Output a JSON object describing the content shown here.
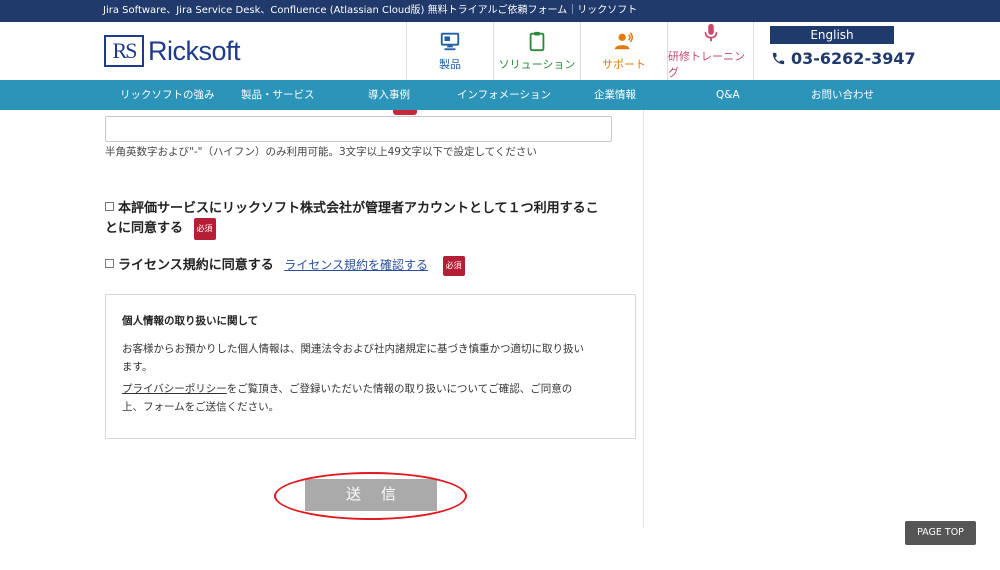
{
  "topbar": {
    "text": "Jira Software、Jira Service Desk、Confluence (Atlassian Cloud版) 無料トライアルご依頼フォーム｜リックソフト"
  },
  "logo": {
    "mark": "RS",
    "name": "Ricksoft"
  },
  "header_nav": [
    {
      "label": "製品",
      "icon": "product-icon",
      "color": "#1f5fa8"
    },
    {
      "label": "ソリューション",
      "icon": "clipboard-icon",
      "color": "#2a8a3a"
    },
    {
      "label": "サポート",
      "icon": "support-icon",
      "color": "#e07b10"
    },
    {
      "label": "研修トレーニング",
      "icon": "microphone-icon",
      "color": "#c8476a"
    }
  ],
  "language_button": "English",
  "phone": "03-6262-3947",
  "main_nav": [
    "リックソフトの強み",
    "製品・サービス",
    "導入事例",
    "インフォメーション",
    "企業情報",
    "Q&A",
    "お問い合わせ"
  ],
  "form": {
    "input_value": "",
    "input_hint": "半角英数字および\"-\"（ハイフン）のみ利用可能。3文字以上49文字以下で設定してください",
    "admin_consent_line1": "本評価サービスにリックソフト株式会社が管理者アカウントとして１つ利用するこ",
    "admin_consent_line2": "とに同意する",
    "required_badge": "必須",
    "license_consent": "ライセンス規約に同意する",
    "license_link": "ライセンス規約を確認する",
    "submit_label": "送信"
  },
  "privacy": {
    "heading": "個人情報の取り扱いに関して",
    "para1_line1": "お客様からお預かりした個人情報は、関連法令および社内諸規定に基づき慎重かつ適切に取り扱い",
    "para1_line2": "ます。",
    "para2_link": "プライバシーポリシー",
    "para2_line1_rest": "をご覧頂き、ご登録いただいた情報の取り扱いについてご確認、ご同意の",
    "para2_line2": "上、フォームをご送信ください。"
  },
  "page_top": "PAGE TOP",
  "colors": {
    "topbar": "#1f3a6b",
    "navbar": "#2c94b8",
    "required": "#b51f35",
    "annotation": "#e01820"
  }
}
